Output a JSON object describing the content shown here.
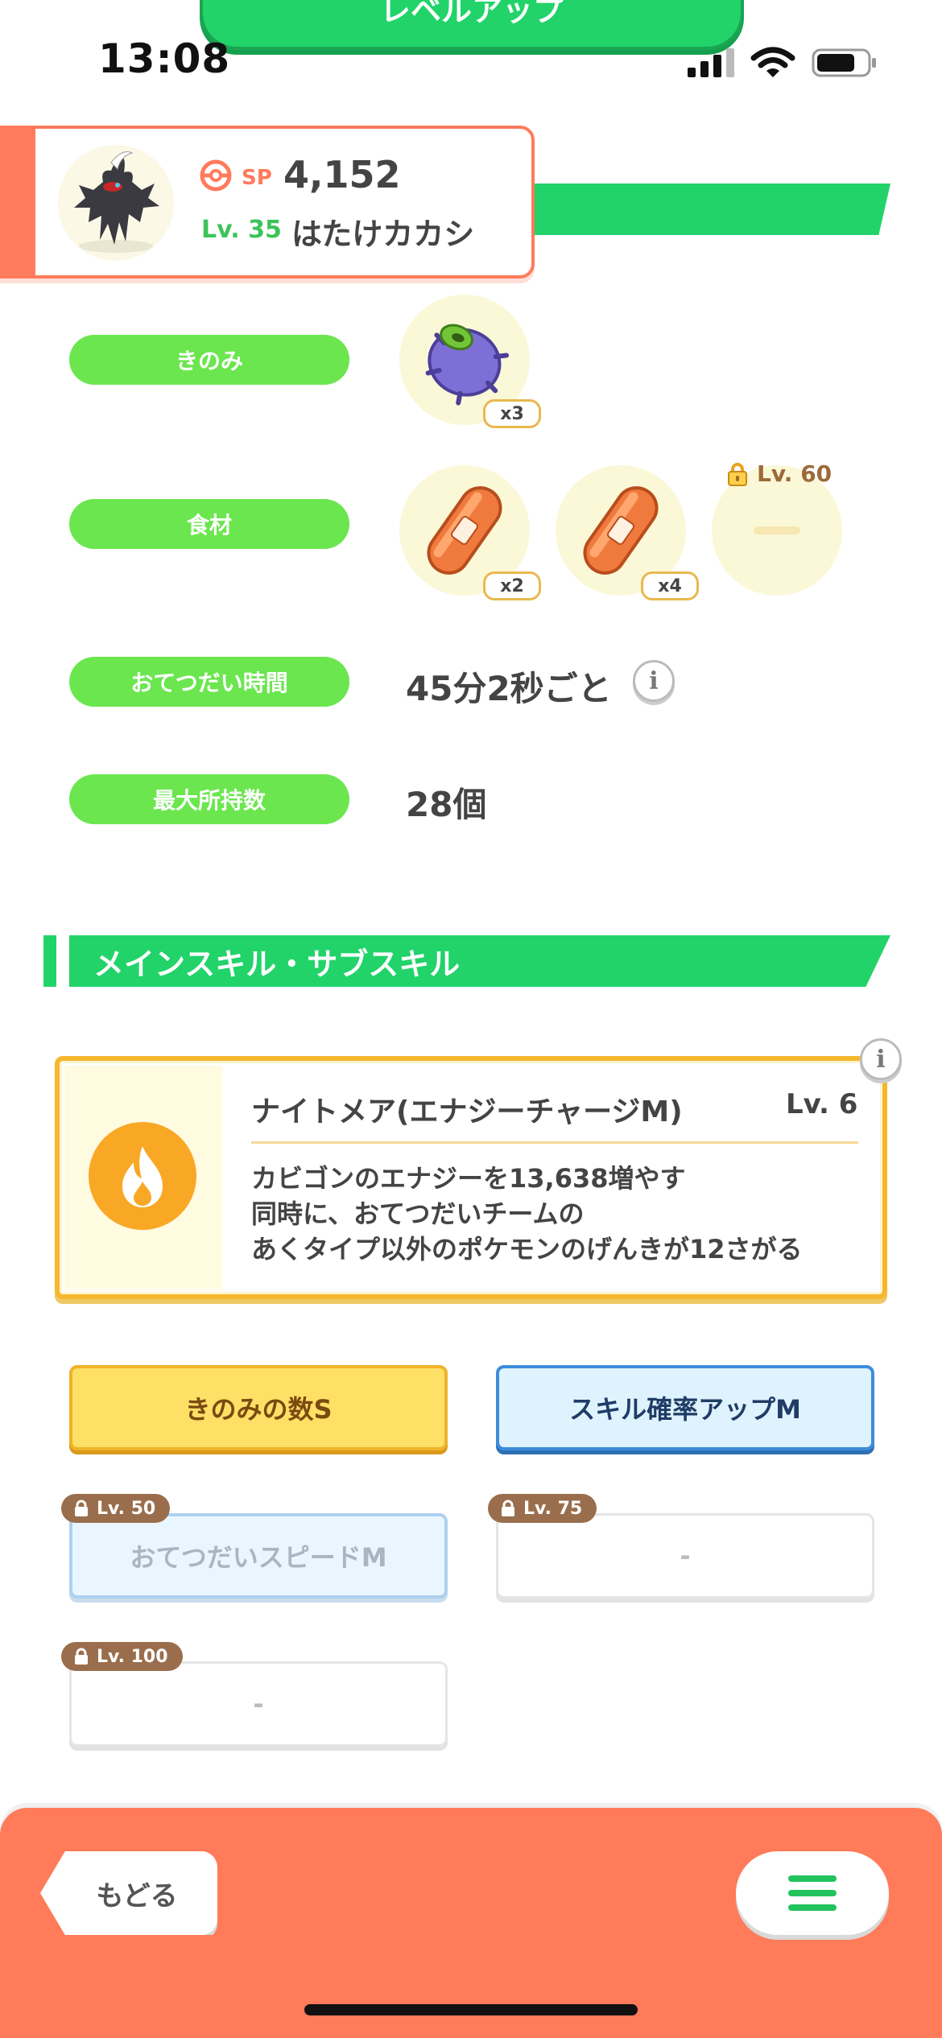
{
  "top_button": {
    "label": "レベルアップ"
  },
  "status_bar": {
    "time": "13:08"
  },
  "pokemon": {
    "sp_label": "SP",
    "sp_value": "4,152",
    "level": "Lv. 35",
    "name": "はたけカカシ"
  },
  "stats": {
    "berry": {
      "label": "きのみ",
      "qty": "x3"
    },
    "ingredients": {
      "label": "食材",
      "items": [
        {
          "qty": "x2"
        },
        {
          "qty": "x4"
        }
      ],
      "locked_level": "Lv. 60"
    },
    "help_time": {
      "label": "おてつだい時間",
      "value": "45分2秒ごと"
    },
    "max_carry": {
      "label": "最大所持数",
      "value": "28個"
    }
  },
  "skills_section": {
    "title": "メインスキル・サブスキル",
    "main_skill": {
      "name": "ナイトメア(エナジーチャージM)",
      "level": "Lv. 6",
      "desc_line1": "カビゴンのエナジーを13,638増やす",
      "desc_line2": "同時に、おてつだいチームの",
      "desc_line3": "あくタイプ以外のポケモンのげんきが12さがる"
    },
    "sub_skills": [
      {
        "label": "きのみの数S"
      },
      {
        "label": "スキル確率アップM"
      },
      {
        "label": "おてつだいスピードM",
        "lock": "Lv. 50"
      },
      {
        "label": "-",
        "lock": "Lv. 75"
      },
      {
        "label": "-",
        "lock": "Lv. 100"
      }
    ]
  },
  "bottom_bar": {
    "back_label": "もどる"
  },
  "colors": {
    "green": "#22d36a",
    "pill_green": "#6be64f",
    "coral": "#ff7b5a",
    "gold": "#f5b72e"
  }
}
